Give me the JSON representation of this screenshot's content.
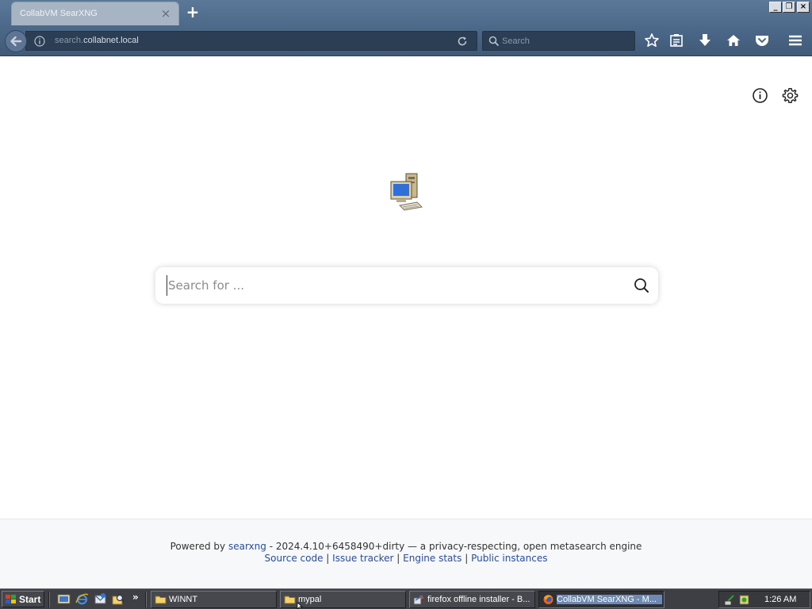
{
  "browser": {
    "tab_title": "CollabVM SearXNG",
    "tab_close": "×",
    "new_tab": "+",
    "url_prefix": "search.",
    "url_domain": "collabnet.local",
    "search_placeholder": "Search",
    "window_buttons": [
      "_",
      "❐",
      "×"
    ]
  },
  "page": {
    "search_placeholder": "Search for ...",
    "footer": {
      "powered_by": "Powered by",
      "engine_link": "searxng",
      "version_text": "- 2024.4.10+6458490+dirty — a privacy-respecting, open metasearch engine",
      "links": [
        "Source code",
        "Issue tracker",
        "Engine stats",
        "Public instances"
      ],
      "separator": "|"
    }
  },
  "taskbar": {
    "start_label": "Start",
    "chevron": "»",
    "tasks": [
      {
        "label": "WINNT",
        "icon": "folder-icon",
        "active": false
      },
      {
        "label": "mypal",
        "icon": "folder-icon",
        "active": false
      },
      {
        "label": "firefox offline installer - B...",
        "icon": "download-icon",
        "active": false
      },
      {
        "label": "CollabVM SearXNG - M...",
        "icon": "firefox-icon",
        "active": true
      }
    ],
    "clock": "1:26 AM"
  },
  "colors": {
    "chrome_bg": "#4d6a8b",
    "urlbar_bg": "#2c3e53",
    "link": "#2a4ba0",
    "taskbar_bg": "#3d3f44",
    "active_task_highlight": "#6e8ab2"
  }
}
